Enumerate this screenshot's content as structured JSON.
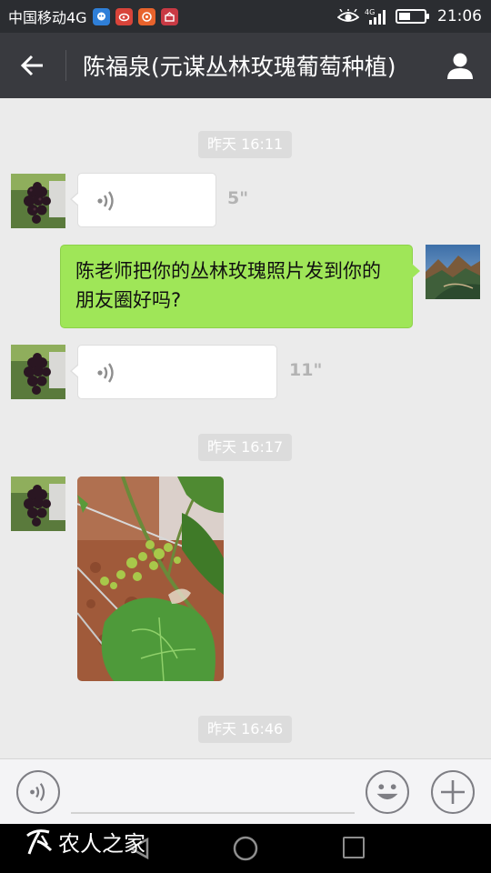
{
  "status_bar": {
    "carrier": "中国移动4G",
    "network_label": "4G",
    "time": "21:06",
    "battery_level": 0.45,
    "app_icons": [
      "qq-icon",
      "weibo-icon",
      "taobao-icon",
      "app-icon"
    ]
  },
  "header": {
    "title": "陈福泉(元谋丛林玫瑰葡萄种植)"
  },
  "messages": {
    "ts1": "昨天 16:11",
    "voice1_duration": "5\"",
    "text1": "陈老师把你的丛林玫瑰照片发到你的朋友圈好吗?",
    "voice2_duration": "11\"",
    "ts2": "昨天 16:17",
    "ts3": "昨天 16:46"
  },
  "watermark": {
    "text": "农人之家"
  },
  "colors": {
    "title_bar": "#393a3f",
    "status_bar": "#2b2d31",
    "chat_background": "#ebebeb",
    "outgoing_bubble": "#9fe658",
    "incoming_bubble": "#ffffff"
  }
}
